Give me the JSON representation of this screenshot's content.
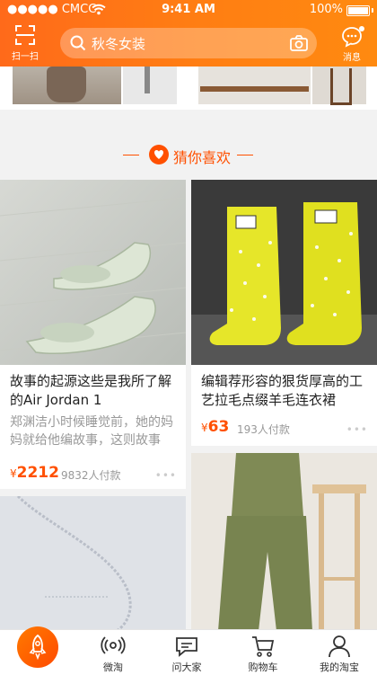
{
  "status_bar": {
    "carrier": "●●●●● CMCC",
    "time": "9:41 AM",
    "battery": "100%"
  },
  "header": {
    "scan_label": "扫一扫",
    "search_placeholder": "秋冬女装",
    "message_label": "消息"
  },
  "section": {
    "title": "猜你喜欢"
  },
  "products": [
    {
      "title_line1": "故事的起源这些是我所了解",
      "title_line2": "的Air Jordan 1",
      "desc_line1": "郑渊洁小时候睡觉前，她的妈",
      "desc_line2": "妈就给他编故事，这则故事",
      "currency": "¥",
      "price": "2212",
      "buyers": "9832人付款",
      "more": "•••"
    },
    {
      "title_line1": "编辑荐形容的狠货厚高的工",
      "title_line2": "艺拉毛点缀羊毛连衣裙",
      "currency": "¥",
      "price": "63",
      "buyers": "193人付款",
      "more": "•••"
    }
  ],
  "tabbar": {
    "items": [
      {
        "label": "微淘",
        "icon": "broadcast-icon"
      },
      {
        "label": "问大家",
        "icon": "chat-bubbles-icon"
      },
      {
        "label": "购物车",
        "icon": "cart-icon"
      },
      {
        "label": "我的淘宝",
        "icon": "person-icon"
      }
    ],
    "home_icon": "rocket-icon"
  },
  "colors": {
    "brand": "#ff5000",
    "header": "#ff7a15"
  }
}
